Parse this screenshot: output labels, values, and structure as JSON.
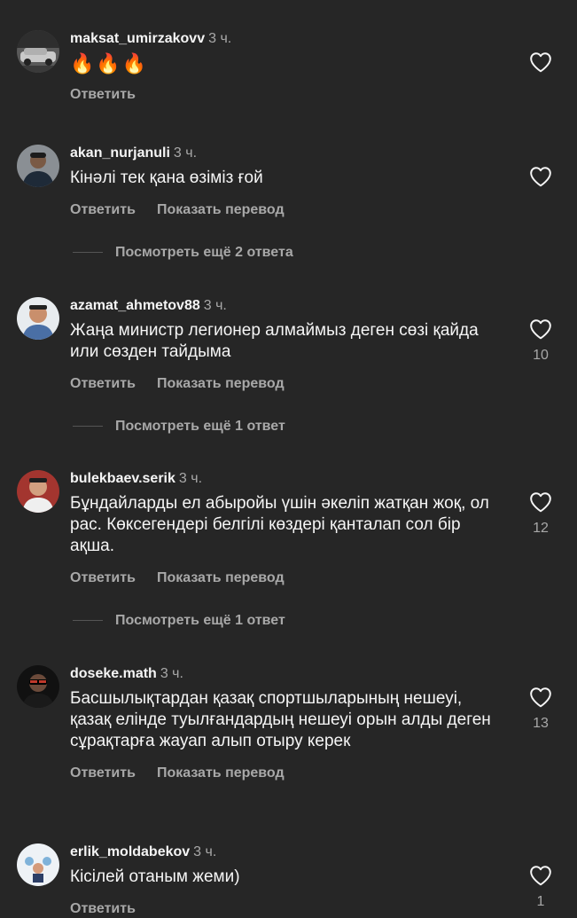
{
  "labels": {
    "reply": "Ответить",
    "translate": "Показать перевод"
  },
  "comments": [
    {
      "username": "maksat_umirzakovv",
      "time": "3 ч.",
      "text": "🔥🔥🔥",
      "likes": ""
    },
    {
      "username": "akan_nurjanuli",
      "time": "3 ч.",
      "text": "Кінәлі тек қана өзіміз ғой",
      "likes": "",
      "more_replies": "Посмотреть ещё 2 ответа"
    },
    {
      "username": "azamat_ahmetov88",
      "time": "3 ч.",
      "text": "Жаңа министр легионер алмаймыз деген сөзі қайда или сөзден тайдыма",
      "likes": "10",
      "more_replies": "Посмотреть ещё 1 ответ"
    },
    {
      "username": "bulekbaev.serik",
      "time": "3 ч.",
      "text": "Бұндайларды ел абыройы үшін әкеліп жатқан жоқ, ол рас. Көксегендері белгілі көздері қанталап сол бір ақша.",
      "likes": "12",
      "more_replies": "Посмотреть ещё 1 ответ"
    },
    {
      "username": "doseke.math",
      "time": "3 ч.",
      "text": "Басшылықтардан қазақ спортшыларының нешеуі, қазақ елінде туылғандардың нешеуі орын алды деген сұрақтарға жауап алып отыру керек",
      "likes": "13"
    },
    {
      "username": "erlik_moldabekov",
      "time": "3 ч.",
      "text": "Кісілей отаным жеми)",
      "likes": "1"
    }
  ],
  "icons": {
    "like": "heart-outline-icon"
  },
  "colors": {
    "background": "#262626",
    "primary_text": "#f5f5f5",
    "secondary_text": "#a8a8a8"
  }
}
